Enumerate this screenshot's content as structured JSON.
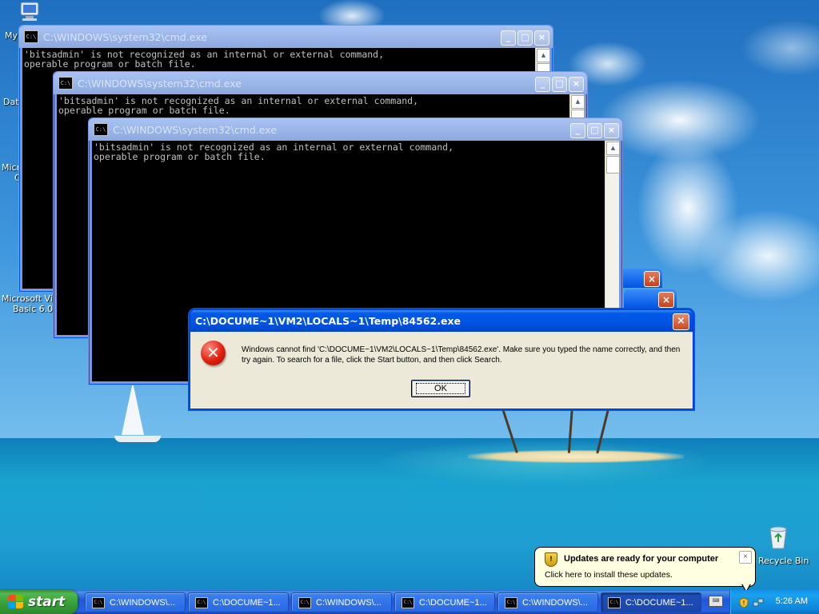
{
  "desktop": {
    "icons": [
      {
        "name": "my-documents-icon",
        "label": "My"
      },
      {
        "name": "data-icon",
        "label": "Dat"
      },
      {
        "name": "microsoft-c-icon",
        "label": "Micro"
      },
      {
        "name": "microsoft-c-icon-line2",
        "label": "C"
      },
      {
        "name": "vb6-icon",
        "label": "Microsoft Visu"
      },
      {
        "name": "vb6-icon-line2",
        "label": "Basic 6.0"
      },
      {
        "name": "recycle-bin-icon",
        "label": "Recycle Bin"
      }
    ]
  },
  "cmd_windows": [
    {
      "title": "C:\\WINDOWS\\system32\\cmd.exe",
      "icon_text": "C:\\",
      "lines": [
        "'bitsadmin' is not recognized as an internal or external command,",
        "operable program or batch file."
      ]
    },
    {
      "title": "C:\\WINDOWS\\system32\\cmd.exe",
      "icon_text": "C:\\",
      "lines": [
        "'bitsadmin' is not recognized as an internal or external command,",
        "operable program or batch file."
      ]
    },
    {
      "title": "C:\\WINDOWS\\system32\\cmd.exe",
      "icon_text": "C:\\",
      "lines": [
        "'bitsadmin' is not recognized as an internal or external command,",
        "operable program or batch file."
      ]
    }
  ],
  "window_buttons": {
    "minimize": "_",
    "maximize": "□",
    "close": "×"
  },
  "dialog": {
    "title": "C:\\DOCUME~1\\VM2\\LOCALS~1\\Temp\\84562.exe",
    "message": "Windows cannot find 'C:\\DOCUME~1\\VM2\\LOCALS~1\\Temp\\84562.exe'. Make sure you typed the name correctly, and then try again. To search for a file, click the Start button, and then click Search.",
    "ok_label": "OK",
    "icon": "error-icon"
  },
  "balloon": {
    "title": "Updates are ready for your computer",
    "text": "Click here to install these updates.",
    "close": "×"
  },
  "taskbar": {
    "start_label": "start",
    "tasks": [
      {
        "label": "C:\\WINDOWS\\...",
        "active": false
      },
      {
        "label": "C:\\DOCUME~1...",
        "active": false
      },
      {
        "label": "C:\\WINDOWS\\...",
        "active": false
      },
      {
        "label": "C:\\DOCUME~1...",
        "active": false
      },
      {
        "label": "C:\\WINDOWS\\...",
        "active": false
      },
      {
        "label": "C:\\DOCUME~1...",
        "active": true
      }
    ],
    "clock": "5:26 AM"
  },
  "colors": {
    "xp_blue": "#0054e3",
    "start_green": "#38a038",
    "console_bg": "#000000",
    "console_text": "#c0c0c0",
    "dialog_face": "#ece9d8",
    "balloon_bg": "#ffffe1"
  }
}
